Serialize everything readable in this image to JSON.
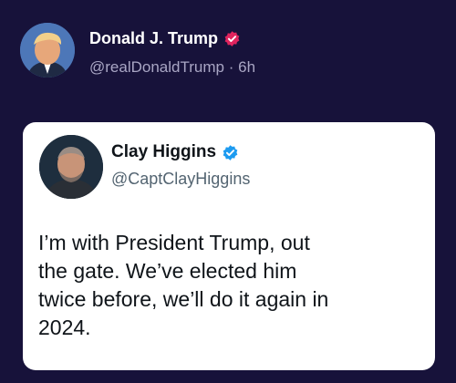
{
  "outer_post": {
    "name": "Donald J. Trump",
    "handle": "@realDonaldTrump",
    "separator": "·",
    "time": "6h",
    "avatar": "portrait-avatar",
    "badge_icon": "verified-badge-icon",
    "badge_color": "#e0245e"
  },
  "quoted_post": {
    "name": "Clay Higgins",
    "handle": "@CaptClayHiggins",
    "avatar": "portrait-avatar",
    "badge_icon": "verified-badge-icon",
    "badge_color": "#1d9bf0",
    "text_lines": [
      "I’m with President Trump, out",
      "the gate. We’ve elected him",
      "twice before, we’ll do it again in",
      "2024."
    ]
  },
  "colors": {
    "background": "#17123a",
    "card": "#ffffff",
    "secondary_text": "#a9a6c4"
  }
}
